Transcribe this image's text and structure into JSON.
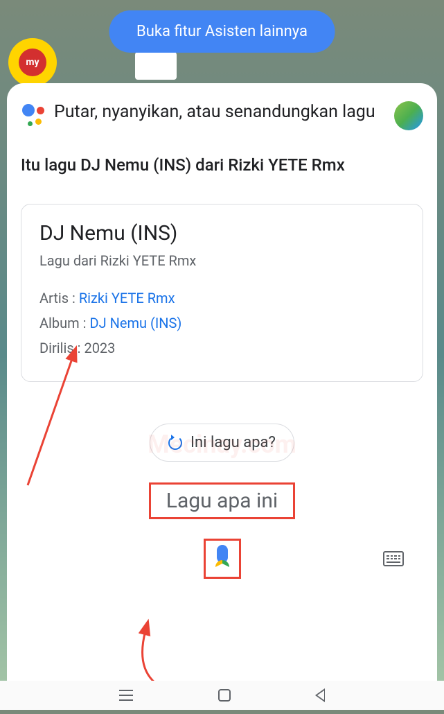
{
  "top_pill": "Buka fitur Asisten lainnya",
  "bg_apps": {
    "app1_label": "my"
  },
  "header": {
    "prompt": "Putar, nyanyikan, atau senandungkan lagu"
  },
  "answer": "Itu lagu DJ Nemu (INS) dari Rizki YETE Rmx",
  "song": {
    "title": "DJ Nemu (INS)",
    "subtitle": "Lagu dari Rizki YETE Rmx",
    "artist_label": "Artis : ",
    "artist": "Rizki YETE Rmx",
    "album_label": "Album : ",
    "album": "DJ Nemu (INS)",
    "released_label": "Dirilis : ",
    "released": "2023"
  },
  "chip": "Ini lagu apa?",
  "query": "Lagu apa ini",
  "watermark": "Mecinay.com"
}
